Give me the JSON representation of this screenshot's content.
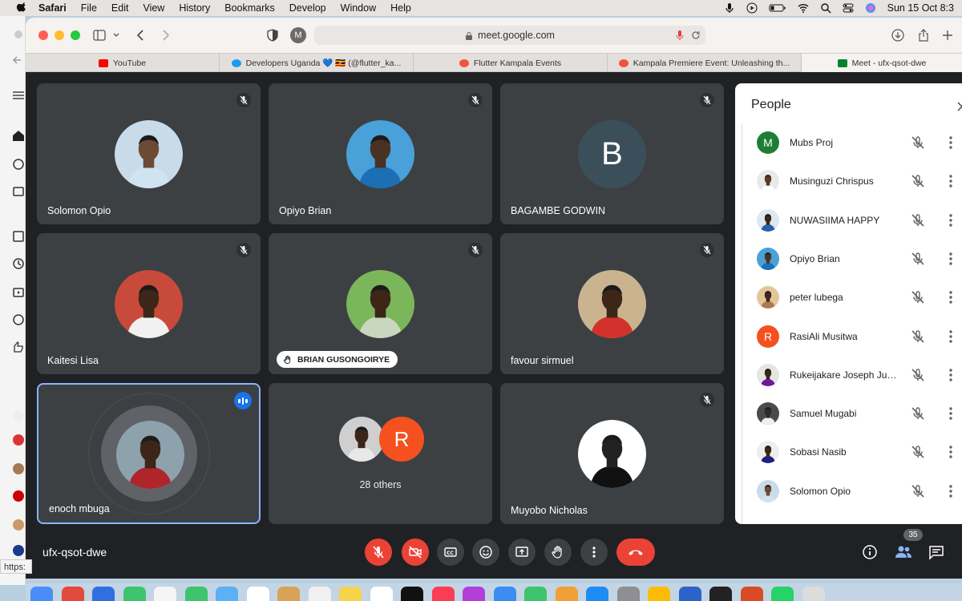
{
  "menubar": {
    "app": "Safari",
    "items": [
      "File",
      "Edit",
      "View",
      "History",
      "Bookmarks",
      "Develop",
      "Window",
      "Help"
    ],
    "clock": "Sun 15 Oct 8:3"
  },
  "browser": {
    "url": "meet.google.com",
    "profile_letter": "M",
    "tabs": [
      {
        "label": "YouTube",
        "favicon_color": "#ff0000"
      },
      {
        "label": "Developers Uganda 💙 🇺🇬 (@flutter_ka...",
        "favicon_color": "#1d9bf0"
      },
      {
        "label": "Flutter Kampala Events",
        "favicon_color": "#f05537"
      },
      {
        "label": "Kampala Premiere Event: Unleashing th...",
        "favicon_color": "#f05537"
      },
      {
        "label": "Meet - ufx-qsot-dwe",
        "favicon_color": "#00832d"
      }
    ],
    "status_url": "https:"
  },
  "meet": {
    "meeting_code": "ufx-qsot-dwe",
    "participant_count": "35",
    "tiles": [
      {
        "name": "Solomon Opio",
        "avatar": "photo",
        "bg": "#c9dbe8",
        "skin": "#6b4a36",
        "shirt": "#cfe3f1",
        "muted": true
      },
      {
        "name": "Opiyo Brian",
        "avatar": "photo",
        "bg": "#4aa0d8",
        "skin": "#4a3122",
        "shirt": "#1b6fb2",
        "muted": true
      },
      {
        "name": "BAGAMBE GODWIN",
        "avatar": "letter",
        "letter": "B",
        "muted": true
      },
      {
        "name": "Kaitesi Lisa",
        "avatar": "photo",
        "bg": "#c84a3a",
        "skin": "#3d2519",
        "shirt": "#f1f1f1",
        "muted": true
      },
      {
        "name": "BRIAN GUSONGOIRYE",
        "avatar": "photo",
        "bg": "#7bb65a",
        "skin": "#3c2618",
        "shirt": "#c9d7c1",
        "muted": true,
        "hand_raised": true
      },
      {
        "name": "favour sirmuel",
        "avatar": "photo",
        "bg": "#c9b48f",
        "skin": "#3c2618",
        "shirt": "#d3322c",
        "muted": true
      },
      {
        "name": "enoch mbuga",
        "avatar": "photo",
        "bg": "#8da2ad",
        "skin": "#3c2618",
        "shirt": "#b0252a",
        "speaking": true
      },
      {
        "name": "28 others",
        "avatar": "group",
        "group_letter": "R"
      },
      {
        "name": "Muyobo Nicholas",
        "avatar": "photo",
        "bg": "#ffffff",
        "skin": "#222222",
        "shirt": "#111111",
        "muted": true
      }
    ]
  },
  "people_panel": {
    "title": "People",
    "participants": [
      {
        "name": "Mubs Proj",
        "avatar": "letter",
        "letter": "M",
        "color": "#1e7e34"
      },
      {
        "name": "Musinguzi Chrispus",
        "avatar": "photo",
        "bg": "#e9e9e9",
        "skin": "#5a3b28",
        "shirt": "#ffffff"
      },
      {
        "name": "NUWASIIMA HAPPY",
        "avatar": "photo",
        "bg": "#dde8f3",
        "skin": "#3c2618",
        "shirt": "#2a5fa7"
      },
      {
        "name": "Opiyo Brian",
        "avatar": "photo",
        "bg": "#4aa0d8",
        "skin": "#4a3122",
        "shirt": "#1b6fb2"
      },
      {
        "name": "peter lubega",
        "avatar": "photo",
        "bg": "#e2c69a",
        "skin": "#3c2618",
        "shirt": "#a67c52"
      },
      {
        "name": "RasiAli Musitwa",
        "avatar": "letter",
        "letter": "R",
        "color": "#f4511e"
      },
      {
        "name": "Rukeijakare Joseph Juni...",
        "avatar": "photo",
        "bg": "#e5e5e5",
        "skin": "#3c2618",
        "shirt": "#6a1b9a"
      },
      {
        "name": "Samuel Mugabi",
        "avatar": "photo",
        "bg": "#4a4a4a",
        "skin": "#2b2b2b",
        "shirt": "#eeeeee"
      },
      {
        "name": "Sobasi Nasib",
        "avatar": "photo",
        "bg": "#eeeeee",
        "skin": "#3c2618",
        "shirt": "#1a237e"
      },
      {
        "name": "Solomon Opio",
        "avatar": "photo",
        "bg": "#c9dbe8",
        "skin": "#6b4a36",
        "shirt": "#cfe3f1"
      }
    ]
  },
  "controls": {
    "mic": "mic-off-icon",
    "camera": "camera-off-icon",
    "captions": "captions-icon",
    "emoji": "emoji-icon",
    "present": "present-icon",
    "hand": "raise-hand-icon",
    "more": "more-options-icon",
    "end": "end-call-icon",
    "info": "info-icon",
    "people": "people-icon",
    "chat": "chat-icon"
  },
  "colors": {
    "meet_bg": "#202124",
    "tile_bg": "#3c4043",
    "accent_blue": "#1a73e8",
    "danger_red": "#ea4335",
    "speaking_border": "#8ab4f8"
  }
}
